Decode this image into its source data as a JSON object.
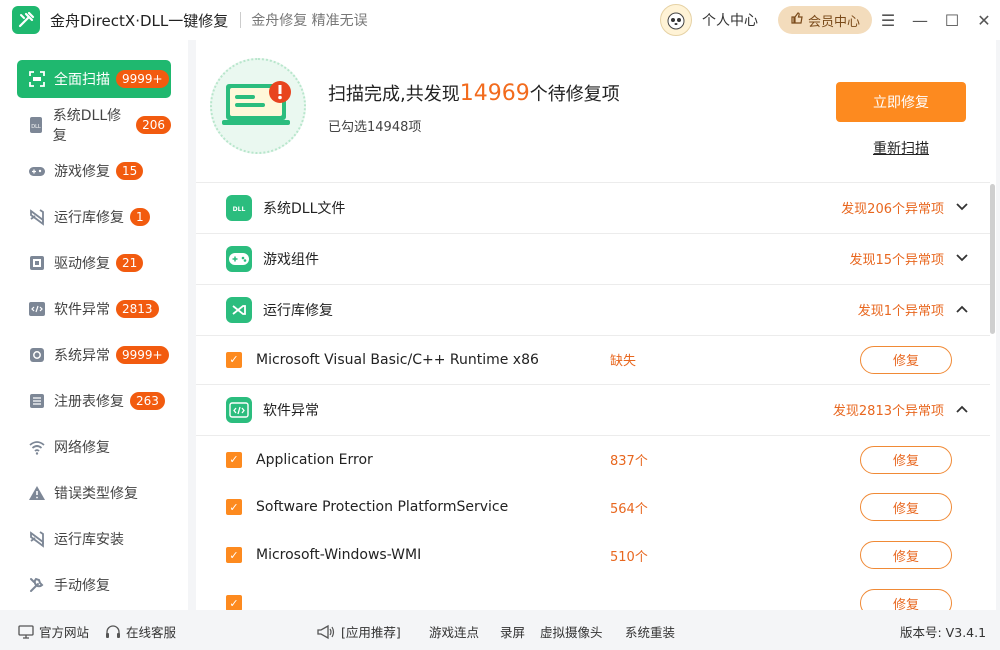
{
  "app": {
    "title": "金舟DirectX·DLL一键修复",
    "slogan": "金舟修复 精准无误"
  },
  "header": {
    "personal_center": "个人中心",
    "vip_center": "会员中心"
  },
  "sidebar": {
    "items": [
      {
        "label": "全面扫描",
        "badge": "9999+",
        "icon": "scan-icon"
      },
      {
        "label": "系统DLL修复",
        "badge": "206",
        "icon": "dll-icon"
      },
      {
        "label": "游戏修复",
        "badge": "15",
        "icon": "gamepad-icon"
      },
      {
        "label": "运行库修复",
        "badge": "1",
        "icon": "runtime-icon"
      },
      {
        "label": "驱动修复",
        "badge": "21",
        "icon": "driver-icon"
      },
      {
        "label": "软件异常",
        "badge": "2813",
        "icon": "code-icon"
      },
      {
        "label": "系统异常",
        "badge": "9999+",
        "icon": "gear-icon"
      },
      {
        "label": "注册表修复",
        "badge": "263",
        "icon": "registry-icon"
      },
      {
        "label": "网络修复",
        "badge": "",
        "icon": "wifi-icon"
      },
      {
        "label": "错误类型修复",
        "badge": "",
        "icon": "warning-icon"
      },
      {
        "label": "运行库安装",
        "badge": "",
        "icon": "install-icon"
      },
      {
        "label": "手动修复",
        "badge": "",
        "icon": "wrench-icon"
      }
    ]
  },
  "summary": {
    "prefix": "扫描完成,共发现",
    "count": "14969",
    "suffix": "个待修复项",
    "selected": "已勾选14948项",
    "repair_now": "立即修复",
    "rescan": "重新扫描"
  },
  "categories": [
    {
      "label": "系统DLL文件",
      "status": "发现206个异常项",
      "chevron": "down"
    },
    {
      "label": "游戏组件",
      "status": "发现15个异常项",
      "chevron": "down"
    },
    {
      "label": "运行库修复",
      "status": "发现1个异常项",
      "chevron": "up"
    },
    {
      "label": "软件异常",
      "status": "发现2813个异常项",
      "chevron": "up"
    }
  ],
  "rows": [
    {
      "name": "Microsoft Visual Basic/C++ Runtime x86",
      "value": "缺失",
      "button": "修复"
    },
    {
      "name": "Application Error",
      "value": "837个",
      "button": "修复"
    },
    {
      "name": "Software Protection PlatformService",
      "value": "564个",
      "button": "修复"
    },
    {
      "name": "Microsoft-Windows-WMI",
      "value": "510个",
      "button": "修复"
    },
    {
      "name": "",
      "value": "",
      "button": "修复"
    }
  ],
  "footer": {
    "official_site": "官方网站",
    "online_service": "在线客服",
    "recommend": "[应用推荐]",
    "links": [
      "游戏连点",
      "录屏",
      "虚拟摄像头",
      "系统重装"
    ],
    "version": "版本号: V3.4.1"
  },
  "colors": {
    "brand_green": "#1fb86f",
    "accent_orange": "#fd8a1f",
    "badge_red": "#f25b0f"
  }
}
